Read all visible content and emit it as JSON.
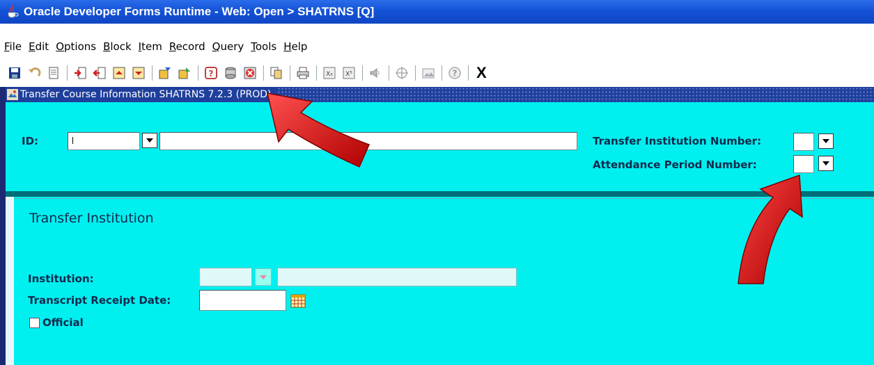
{
  "window": {
    "title": "Oracle Developer Forms Runtime - Web:  Open > SHATRNS [Q]"
  },
  "menu": {
    "items": [
      {
        "accel": "F",
        "rest": "ile"
      },
      {
        "accel": "E",
        "rest": "dit"
      },
      {
        "accel": "O",
        "rest": "ptions"
      },
      {
        "accel": "B",
        "rest": "lock"
      },
      {
        "accel": "I",
        "rest": "tem"
      },
      {
        "accel": "R",
        "rest": "ecord"
      },
      {
        "accel": "Q",
        "rest": "uery"
      },
      {
        "accel": "T",
        "rest": "ools"
      },
      {
        "accel": "H",
        "rest": "elp"
      }
    ]
  },
  "toolbar": {
    "exit_label": "X",
    "icons": [
      "save-icon",
      "rollback-icon",
      "print-page-icon",
      "insert-record-icon",
      "remove-record-icon",
      "previous-block-icon",
      "next-block-icon",
      "enter-query-icon",
      "execute-query-icon",
      "help-icon",
      "options-icon",
      "cancel-query-icon",
      "copy-icon",
      "print-icon",
      "previous-record-icon",
      "next-record-icon",
      "speaker-icon",
      "crosshair-icon",
      "image-icon",
      "question-icon"
    ]
  },
  "form_header": {
    "text": "Transfer Course Information  SHATRNS  7.2.3  (PROD)"
  },
  "key_block": {
    "id_label": "ID:",
    "id_value": "",
    "id_name": "",
    "transfer_institution_label": "Transfer Institution Number:",
    "transfer_institution_value": "",
    "attendance_period_label": "Attendance Period Number:",
    "attendance_period_value": ""
  },
  "main_block": {
    "section_title": "Transfer Institution",
    "institution_label": "Institution:",
    "institution_code": "",
    "institution_name": "",
    "transcript_date_label": "Transcript Receipt Date:",
    "transcript_date_value": "",
    "official_label": "Official",
    "official_checked": false
  },
  "colors": {
    "canvas": "#00f0f0",
    "title_bar": "#1453d6",
    "header_strip": "#1f3f9c",
    "label_text": "#102a4c",
    "arrow": "#e01010"
  }
}
